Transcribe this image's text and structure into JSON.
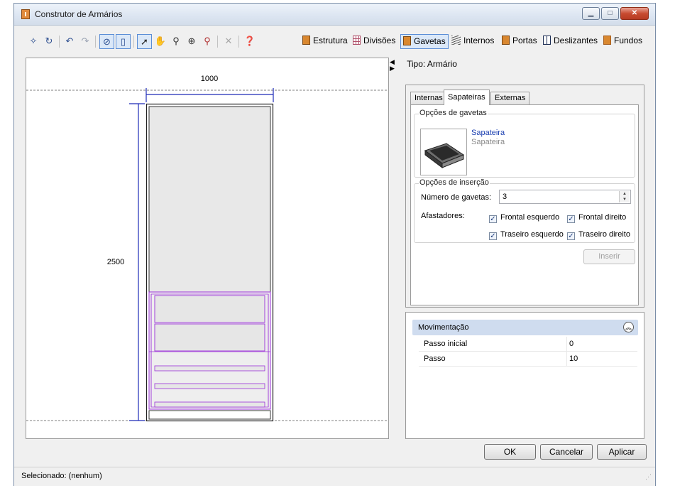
{
  "window": {
    "title": "Construtor de Armários"
  },
  "toolbar": {
    "tabs": [
      {
        "label": "Estrutura",
        "icon": "cabinet-icon"
      },
      {
        "label": "Divisões",
        "icon": "grid-icon"
      },
      {
        "label": "Gavetas",
        "icon": "drawer-icon"
      },
      {
        "label": "Internos",
        "icon": "shelves-icon"
      },
      {
        "label": "Portas",
        "icon": "door-icon"
      },
      {
        "label": "Deslizantes",
        "icon": "sliding-door-icon"
      },
      {
        "label": "Fundos",
        "icon": "back-panel-icon"
      }
    ]
  },
  "drawing": {
    "width_label": "1000",
    "height_label": "2500"
  },
  "panel": {
    "type_label": "Tipo: Armário",
    "tabs": [
      "Internas",
      "Sapateiras",
      "Externas"
    ],
    "drawer_options_legend": "Opções de gavetas",
    "item_name": "Sapateira",
    "item_desc": "Sapateira",
    "insert_options_legend": "Opções de inserção",
    "drawer_count_label": "Número de gavetas:",
    "drawer_count_value": "3",
    "spacers_label": "Afastadores:",
    "checks": {
      "front_left": "Frontal esquerdo",
      "front_right": "Frontal direito",
      "back_left": "Traseiro esquerdo",
      "back_right": "Traseiro direito"
    },
    "insert_button": "Inserir"
  },
  "movement": {
    "title": "Movimentação",
    "rows": [
      {
        "key": "Passo inicial",
        "value": "0"
      },
      {
        "key": "Passo",
        "value": "10"
      }
    ]
  },
  "buttons": {
    "ok": "OK",
    "cancel": "Cancelar",
    "apply": "Aplicar"
  },
  "status": {
    "text": "Selecionado: (nenhum)"
  },
  "colors": {
    "selection_purple": "#9b30d9",
    "dimension_blue": "#1f2bb8",
    "accent": "#5b8ed6"
  }
}
